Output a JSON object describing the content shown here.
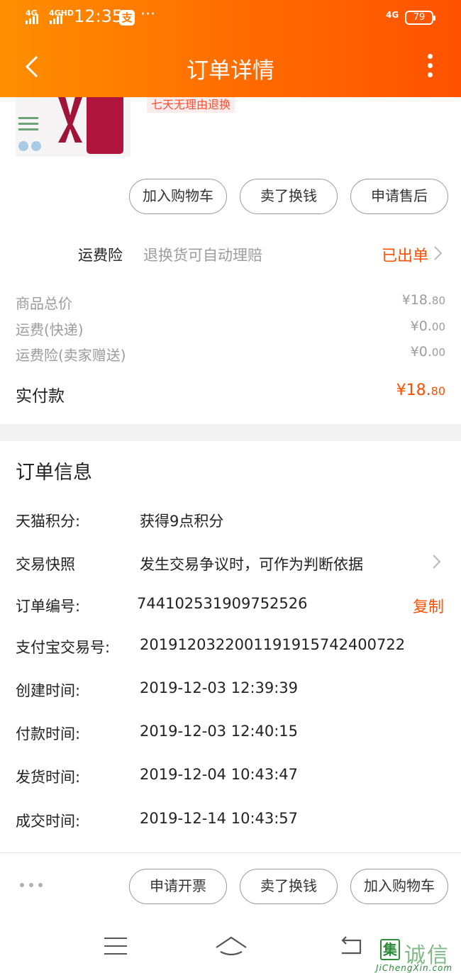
{
  "colors": {
    "accent": "#ff5000",
    "header_start": "#ff8f00",
    "header_end": "#ff5200"
  },
  "status_bar": {
    "sim1": "4G",
    "sim2": "4GHD",
    "time": "12:35",
    "app_icon": "支",
    "more": "···",
    "network_right": "4G",
    "battery": "79"
  },
  "header": {
    "title": "订单详情",
    "back_icon": "chevron-left-icon",
    "more_icon": "vertical-dots-icon"
  },
  "product": {
    "return_tag": "七天无理由退换"
  },
  "actions_top": [
    "加入购物车",
    "卖了换钱",
    "申请售后"
  ],
  "insurance": {
    "label": "运费险",
    "description": "退换货可自动理赔",
    "status": "已出单"
  },
  "prices": [
    {
      "label": "商品总价",
      "currency": "¥",
      "int": "18.",
      "dec": "80"
    },
    {
      "label": "运费(快递)",
      "currency": "¥",
      "int": "0.",
      "dec": "00"
    },
    {
      "label": "运费险(卖家赠送)",
      "currency": "¥",
      "int": "0.",
      "dec": "00"
    }
  ],
  "total": {
    "label": "实付款",
    "currency": "¥",
    "int": "18.",
    "dec": "80"
  },
  "order_info": {
    "title": "订单信息",
    "rows": [
      {
        "label": "天猫积分:",
        "value": "获得9点积分"
      },
      {
        "label": "交易快照",
        "value": "发生交易争议时，可作为判断依据"
      },
      {
        "label": "订单编号:",
        "value": "744102531909752526"
      },
      {
        "label": "支付宝交易号:",
        "value": "2019120322001191915742400722"
      },
      {
        "label": "创建时间:",
        "value": "2019-12-03 12:39:39"
      },
      {
        "label": "付款时间:",
        "value": "2019-12-03 12:40:15"
      },
      {
        "label": "发货时间:",
        "value": "2019-12-04 10:43:47"
      },
      {
        "label": "成交时间:",
        "value": "2019-12-14 10:43:57"
      }
    ],
    "copy_label": "复制"
  },
  "actions_bottom": [
    "申请开票",
    "卖了换钱",
    "加入购物车"
  ],
  "watermark": {
    "box_char": "集",
    "text": "诚信",
    "url": "JiChengXin.com"
  }
}
